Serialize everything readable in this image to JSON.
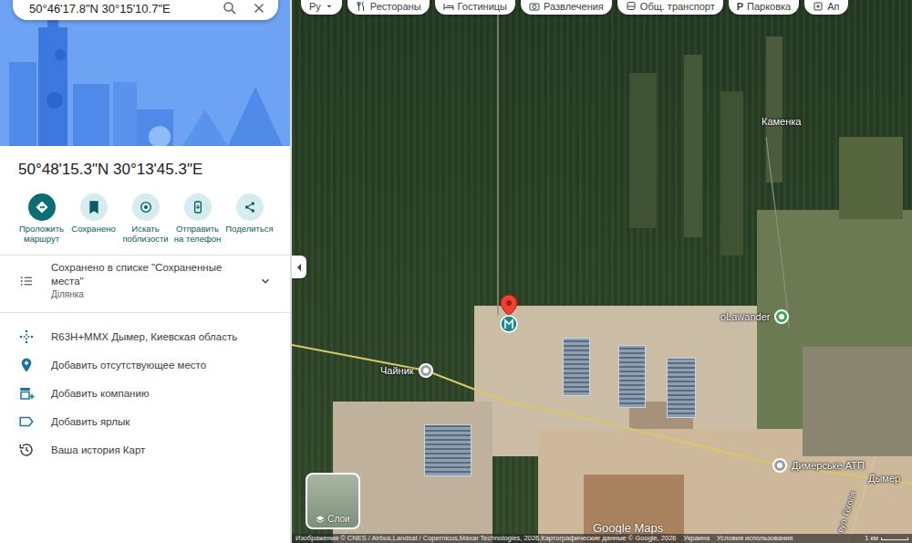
{
  "search": {
    "value": "50°46'17.8\"N 30°15'10.7\"E"
  },
  "chips": [
    {
      "label": "Ру",
      "kind": "language"
    },
    {
      "label": "Рестораны",
      "kind": "category"
    },
    {
      "label": "Гостиницы",
      "kind": "category"
    },
    {
      "label": "Развлечения",
      "kind": "category"
    },
    {
      "label": "Общ. транспорт",
      "kind": "category"
    },
    {
      "label": "Парковка",
      "kind": "category",
      "glyph": "P"
    },
    {
      "label": "Ап",
      "kind": "category"
    }
  ],
  "place": {
    "title": "50°48'15.3\"N 30°13'45.3\"E",
    "actions": [
      {
        "label": "Проложить маршрут",
        "kind": "primary",
        "on": false
      },
      {
        "label": "Сохранено",
        "kind": "toggle",
        "on": true
      },
      {
        "label": "Искать поблизости",
        "kind": "plain",
        "on": false
      },
      {
        "label": "Отправить на телефон",
        "kind": "plain",
        "on": false
      },
      {
        "label": "Поделиться",
        "kind": "plain",
        "on": false
      }
    ],
    "saved": {
      "text": "Сохранено в списке \"Сохраненные места\"",
      "subtitle": "Ділянка",
      "expanded": false
    },
    "details": [
      "R63H+MMX Дымер, Киевская область",
      "Добавить отсутствующее место",
      "Добавить компанию",
      "Добавить ярлык",
      "Ваша история Карт"
    ]
  },
  "map": {
    "marker": {
      "saved": true
    },
    "labels": [
      {
        "text": "Каменка",
        "pin": false
      },
      {
        "text": "oLawander",
        "pin": true,
        "color": "#34a853"
      },
      {
        "text": "Чайник",
        "pin": true,
        "color": "#9aa0a6"
      },
      {
        "text": "Димерське АТП",
        "pin": true,
        "color": "#9aa0a6"
      },
      {
        "text": "Дымер",
        "pin": false
      },
      {
        "text": "вул. Гоголя",
        "pin": false
      }
    ],
    "layers": "Слои",
    "watermark": "Google Maps",
    "attribution": "Изображения © CNES / Airbus,Landsat / Copernicus,Maxar Technologies, 2026,Картографические данные © Google, 2026",
    "region": "Украина",
    "terms": "Условия использования",
    "scale": "1 км"
  }
}
